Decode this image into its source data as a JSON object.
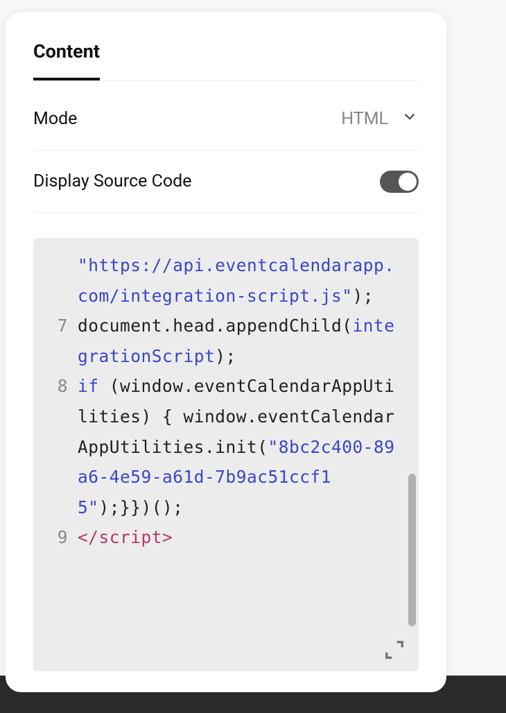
{
  "tabs": {
    "content_label": "Content"
  },
  "settings": {
    "mode_label": "Mode",
    "mode_value": "HTML",
    "toggle_label": "Display Source Code",
    "toggle_on": true
  },
  "code": {
    "lines": [
      {
        "n": "",
        "segments": [
          {
            "t": "\"https://api.eventcalendarapp.com/integration-script.js\"",
            "c": "tok-str"
          },
          {
            "t": ");",
            "c": ""
          }
        ]
      },
      {
        "n": "7",
        "segments": [
          {
            "t": "document.head.appendChild(",
            "c": ""
          },
          {
            "t": "integrationScript",
            "c": "tok-var"
          },
          {
            "t": ");",
            "c": ""
          }
        ]
      },
      {
        "n": "8",
        "segments": [
          {
            "t": "if",
            "c": "tok-kw"
          },
          {
            "t": " (window.eventCalendarAppUtilities) { window.eventCalendarAppUtilities.init(",
            "c": ""
          },
          {
            "t": "\"8bc2c400-89a6-4e59-a61d-7b9ac51ccf15\"",
            "c": "tok-str"
          },
          {
            "t": ");}})();",
            "c": ""
          }
        ]
      },
      {
        "n": "9",
        "segments": [
          {
            "t": "</script​>",
            "c": "tok-tag"
          }
        ]
      }
    ]
  }
}
